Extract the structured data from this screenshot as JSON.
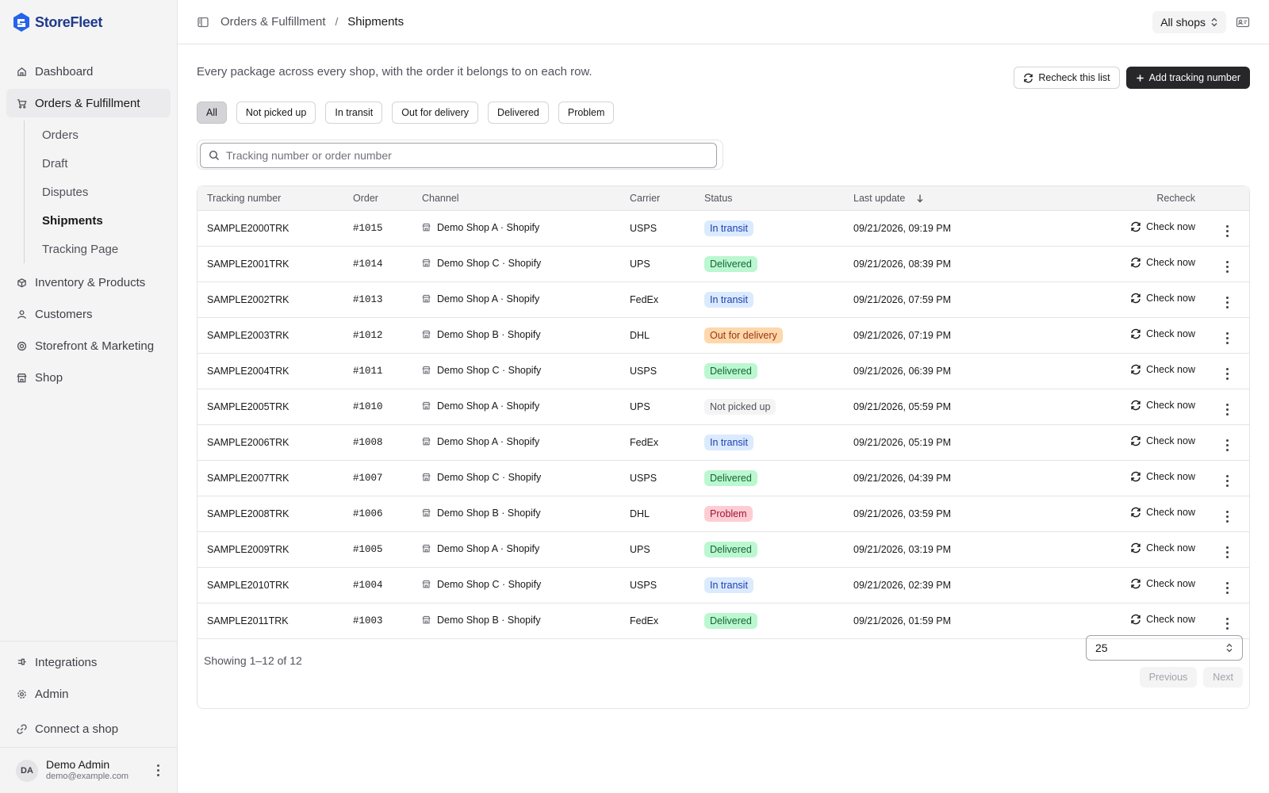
{
  "app": {
    "name": "StoreFleet"
  },
  "sidebar": {
    "items": [
      {
        "label": "Dashboard",
        "icon": "home-icon"
      },
      {
        "label": "Orders & Fulfillment",
        "icon": "cart-icon"
      },
      {
        "label": "Inventory & Products",
        "icon": "package-icon"
      },
      {
        "label": "Customers",
        "icon": "user-icon"
      },
      {
        "label": "Storefront & Marketing",
        "icon": "target-icon"
      },
      {
        "label": "Shop",
        "icon": "store-icon"
      }
    ],
    "sub_items": [
      {
        "label": "Orders"
      },
      {
        "label": "Draft"
      },
      {
        "label": "Disputes"
      },
      {
        "label": "Shipments"
      },
      {
        "label": "Tracking Page"
      }
    ],
    "bottom_items": [
      {
        "label": "Integrations",
        "icon": "plug-icon"
      },
      {
        "label": "Admin",
        "icon": "gear-icon"
      },
      {
        "label": "Connect a shop",
        "icon": "link-icon"
      }
    ],
    "user": {
      "initials": "DA",
      "name": "Demo Admin",
      "email": "demo@example.com"
    }
  },
  "header": {
    "breadcrumb_parent": "Orders & Fulfillment",
    "breadcrumb_separator": "/",
    "breadcrumb_current": "Shipments",
    "shop_select": "All shops"
  },
  "page": {
    "description": "Every package across every shop, with the order it belongs to on each row.",
    "recheck_list_label": "Recheck this list",
    "add_tracking_label": "Add tracking number",
    "search_placeholder": "Tracking number or order number"
  },
  "filters": [
    "All",
    "Not picked up",
    "In transit",
    "Out for delivery",
    "Delivered",
    "Problem"
  ],
  "active_filter": "All",
  "table": {
    "columns": {
      "tracking": "Tracking number",
      "order": "Order",
      "channel": "Channel",
      "carrier": "Carrier",
      "status": "Status",
      "last_update": "Last update",
      "recheck": "Recheck"
    },
    "check_now_label": "Check now",
    "rows": [
      {
        "tracking": "SAMPLE2000TRK",
        "order": "#1015",
        "channel": "Demo Shop A · Shopify",
        "carrier": "USPS",
        "status": "In transit",
        "updated": "09/21/2026, 09:19 PM"
      },
      {
        "tracking": "SAMPLE2001TRK",
        "order": "#1014",
        "channel": "Demo Shop C · Shopify",
        "carrier": "UPS",
        "status": "Delivered",
        "updated": "09/21/2026, 08:39 PM"
      },
      {
        "tracking": "SAMPLE2002TRK",
        "order": "#1013",
        "channel": "Demo Shop A · Shopify",
        "carrier": "FedEx",
        "status": "In transit",
        "updated": "09/21/2026, 07:59 PM"
      },
      {
        "tracking": "SAMPLE2003TRK",
        "order": "#1012",
        "channel": "Demo Shop B · Shopify",
        "carrier": "DHL",
        "status": "Out for delivery",
        "updated": "09/21/2026, 07:19 PM"
      },
      {
        "tracking": "SAMPLE2004TRK",
        "order": "#1011",
        "channel": "Demo Shop C · Shopify",
        "carrier": "USPS",
        "status": "Delivered",
        "updated": "09/21/2026, 06:39 PM"
      },
      {
        "tracking": "SAMPLE2005TRK",
        "order": "#1010",
        "channel": "Demo Shop A · Shopify",
        "carrier": "UPS",
        "status": "Not picked up",
        "updated": "09/21/2026, 05:59 PM"
      },
      {
        "tracking": "SAMPLE2006TRK",
        "order": "#1008",
        "channel": "Demo Shop A · Shopify",
        "carrier": "FedEx",
        "status": "In transit",
        "updated": "09/21/2026, 05:19 PM"
      },
      {
        "tracking": "SAMPLE2007TRK",
        "order": "#1007",
        "channel": "Demo Shop C · Shopify",
        "carrier": "USPS",
        "status": "Delivered",
        "updated": "09/21/2026, 04:39 PM"
      },
      {
        "tracking": "SAMPLE2008TRK",
        "order": "#1006",
        "channel": "Demo Shop B · Shopify",
        "carrier": "DHL",
        "status": "Problem",
        "updated": "09/21/2026, 03:59 PM"
      },
      {
        "tracking": "SAMPLE2009TRK",
        "order": "#1005",
        "channel": "Demo Shop A · Shopify",
        "carrier": "UPS",
        "status": "Delivered",
        "updated": "09/21/2026, 03:19 PM"
      },
      {
        "tracking": "SAMPLE2010TRK",
        "order": "#1004",
        "channel": "Demo Shop C · Shopify",
        "carrier": "USPS",
        "status": "In transit",
        "updated": "09/21/2026, 02:39 PM"
      },
      {
        "tracking": "SAMPLE2011TRK",
        "order": "#1003",
        "channel": "Demo Shop B · Shopify",
        "carrier": "FedEx",
        "status": "Delivered",
        "updated": "09/21/2026, 01:59 PM"
      }
    ]
  },
  "status_colors": {
    "In transit": {
      "bg": "#dbeafe",
      "fg": "#1e40af"
    },
    "Delivered": {
      "bg": "#bbf7d0",
      "fg": "#166534"
    },
    "Out for delivery": {
      "bg": "#fed7aa",
      "fg": "#9a3412"
    },
    "Not picked up": {
      "bg": "#f4f4f5",
      "fg": "#52525b"
    },
    "Problem": {
      "bg": "#fecdd3",
      "fg": "#9f1239"
    }
  },
  "pagination": {
    "showing": "Showing 1–12 of 12",
    "page_size": "25",
    "previous": "Previous",
    "next": "Next"
  },
  "colors": {
    "brand": "#1e3a8a",
    "primary_button": "#27272a"
  }
}
